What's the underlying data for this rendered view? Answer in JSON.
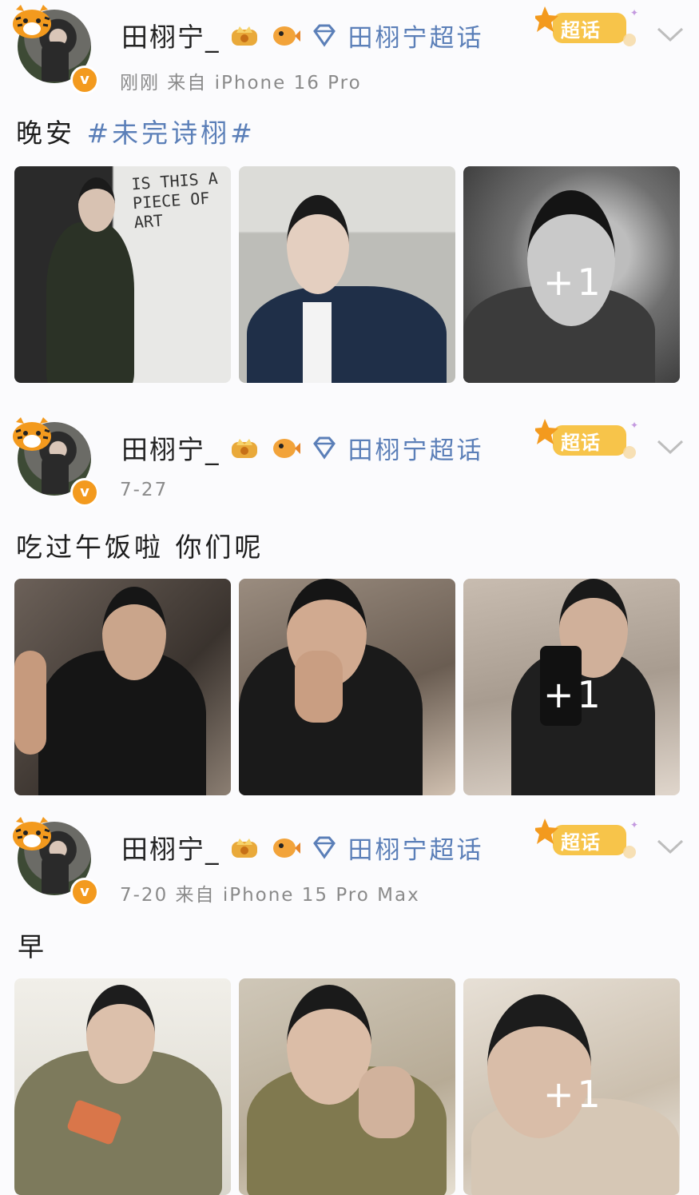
{
  "posts": [
    {
      "username": "田栩宁_",
      "supertopic": "田栩宁超话",
      "chaohua_label": "超话",
      "meta": "刚刚  来自 iPhone 16 Pro",
      "content_text": "晚安",
      "hashtag": "#未完诗栩#",
      "photos": [
        {
          "overlay": "IS THIS A PIECE OF ART"
        },
        {
          "overlay": ""
        },
        {
          "overlay": "+1"
        }
      ]
    },
    {
      "username": "田栩宁_",
      "supertopic": "田栩宁超话",
      "chaohua_label": "超话",
      "meta": "7-27",
      "content_text": "吃过午饭啦 你们呢",
      "hashtag": "",
      "photos": [
        {
          "overlay": ""
        },
        {
          "overlay": ""
        },
        {
          "overlay": "+1"
        }
      ]
    },
    {
      "username": "田栩宁_",
      "supertopic": "田栩宁超话",
      "chaohua_label": "超话",
      "meta": "7-20  来自 iPhone 15 Pro Max",
      "content_text": "早",
      "hashtag": "",
      "photos": [
        {
          "overlay": ""
        },
        {
          "overlay": ""
        },
        {
          "overlay": "+1"
        }
      ]
    }
  ],
  "colors": {
    "accent_link": "#5b7fb8",
    "verified_badge": "#f39a1e",
    "chaohua_badge": "#f7c44a"
  },
  "icons": [
    "tiger-sticker-icon",
    "verified-v-icon",
    "crown-badge-icon",
    "pufferfish-badge-icon",
    "diamond-icon",
    "star-icon",
    "chevron-down-icon"
  ]
}
